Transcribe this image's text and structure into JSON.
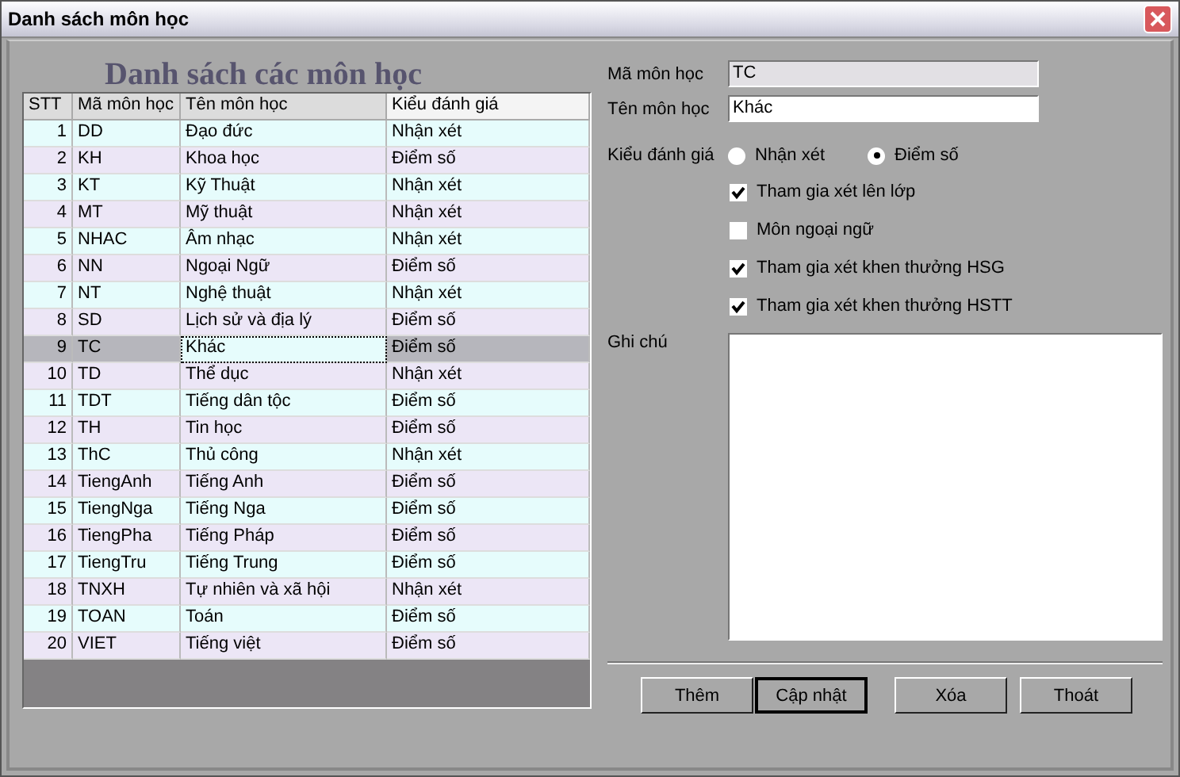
{
  "window": {
    "title": "Danh sách môn học"
  },
  "heading": "Danh sách các môn học",
  "table": {
    "columns": [
      "STT",
      "Mã môn học",
      "Tên môn học",
      "Kiểu đánh giá"
    ],
    "rows": [
      {
        "stt": "1",
        "code": "DD",
        "name": "Đạo đức",
        "type": "Nhận xét",
        "selected": false
      },
      {
        "stt": "2",
        "code": "KH",
        "name": "Khoa học",
        "type": "Điểm số",
        "selected": false
      },
      {
        "stt": "3",
        "code": "KT",
        "name": "Kỹ Thuật",
        "type": "Nhận xét",
        "selected": false
      },
      {
        "stt": "4",
        "code": "MT",
        "name": "Mỹ thuật",
        "type": "Nhận xét",
        "selected": false
      },
      {
        "stt": "5",
        "code": "NHAC",
        "name": "Âm nhạc",
        "type": "Nhận xét",
        "selected": false
      },
      {
        "stt": "6",
        "code": "NN",
        "name": "Ngoại Ngữ",
        "type": "Điểm số",
        "selected": false
      },
      {
        "stt": "7",
        "code": "NT",
        "name": "Nghệ thuật",
        "type": "Nhận xét",
        "selected": false
      },
      {
        "stt": "8",
        "code": "SD",
        "name": "Lịch sử và địa lý",
        "type": "Điểm số",
        "selected": false
      },
      {
        "stt": "9",
        "code": "TC",
        "name": "Khác",
        "type": "Điểm số",
        "selected": true
      },
      {
        "stt": "10",
        "code": "TD",
        "name": "Thể dục",
        "type": "Nhận xét",
        "selected": false
      },
      {
        "stt": "11",
        "code": "TDT",
        "name": "Tiếng dân tộc",
        "type": "Điểm số",
        "selected": false
      },
      {
        "stt": "12",
        "code": "TH",
        "name": "Tin học",
        "type": "Điểm số",
        "selected": false
      },
      {
        "stt": "13",
        "code": "ThC",
        "name": "Thủ công",
        "type": "Nhận xét",
        "selected": false
      },
      {
        "stt": "14",
        "code": "TiengAnh",
        "name": "Tiếng Anh",
        "type": "Điểm số",
        "selected": false
      },
      {
        "stt": "15",
        "code": "TiengNga",
        "name": "Tiếng  Nga",
        "type": "Điểm số",
        "selected": false
      },
      {
        "stt": "16",
        "code": "TiengPha",
        "name": "Tiếng Pháp",
        "type": "Điểm số",
        "selected": false
      },
      {
        "stt": "17",
        "code": "TiengTru",
        "name": "Tiếng Trung",
        "type": "Điểm số",
        "selected": false
      },
      {
        "stt": "18",
        "code": "TNXH",
        "name": "Tự nhiên và xã hội",
        "type": "Nhận xét",
        "selected": false
      },
      {
        "stt": "19",
        "code": "TOAN",
        "name": "Toán",
        "type": "Điểm số",
        "selected": false
      },
      {
        "stt": "20",
        "code": "VIET",
        "name": "Tiếng việt",
        "type": "Điểm số",
        "selected": false
      }
    ]
  },
  "form": {
    "fields": [
      {
        "label": "Mã môn học",
        "value": "TC",
        "disabled": true
      },
      {
        "label": "Tên môn học",
        "value": "Khác",
        "disabled": false
      }
    ],
    "evaluation": {
      "label": "Kiểu đánh giá",
      "options": [
        {
          "label": "Nhận xét",
          "selected": false
        },
        {
          "label": "Điểm số",
          "selected": true
        }
      ]
    },
    "checkboxes": [
      {
        "label": "Tham gia xét lên lớp",
        "checked": true
      },
      {
        "label": "Môn ngoại ngữ",
        "checked": false
      },
      {
        "label": "Tham gia xét khen thưởng HSG",
        "checked": true
      },
      {
        "label": "Tham gia xét khen thưởng HSTT",
        "checked": true
      }
    ],
    "notes": {
      "label": "Ghi chú"
    }
  },
  "buttons": [
    {
      "label": "Thêm",
      "default": false
    },
    {
      "label": "Cập nhật",
      "default": true
    },
    {
      "label": "Xóa",
      "default": false
    },
    {
      "label": "Thoát",
      "default": false
    }
  ]
}
